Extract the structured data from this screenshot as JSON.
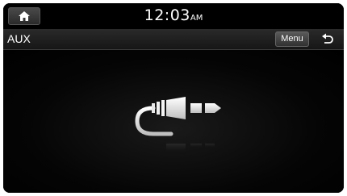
{
  "status_bar": {
    "time": "12:03",
    "ampm": "AM",
    "home_icon": "home-icon"
  },
  "title_bar": {
    "title": "AUX",
    "menu_label": "Menu",
    "back_icon": "back-arrow-icon"
  },
  "content": {
    "icon": "aux-jack-cable-icon"
  }
}
